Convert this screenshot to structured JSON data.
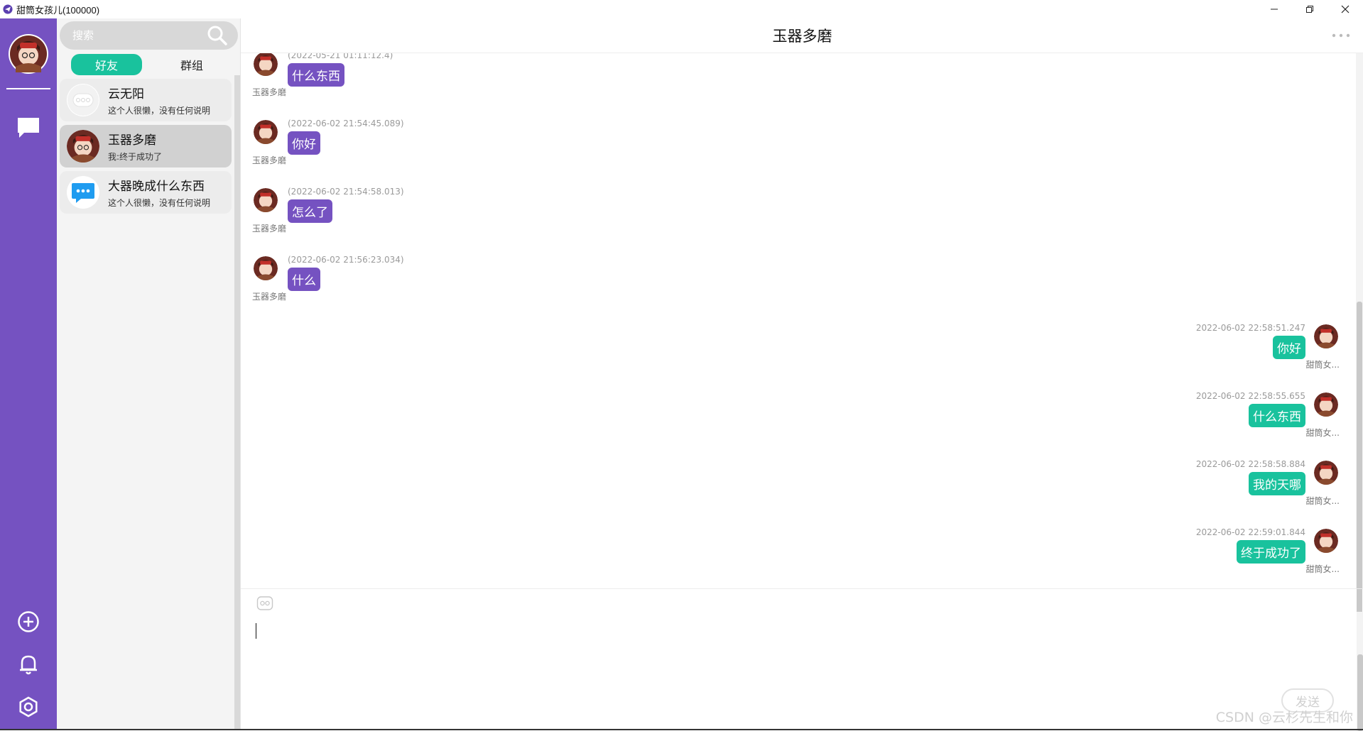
{
  "window": {
    "title": "甜筒女孩儿(100000)",
    "app_icon": "paper-plane-icon",
    "controls": [
      "minimize-icon",
      "restore-icon",
      "close-icon"
    ]
  },
  "colors": {
    "nav_bg": "#7552c1",
    "incoming_bubble": "#7552c1",
    "outgoing_bubble": "#19c29d",
    "active_tab": "#19c29d"
  },
  "nav": {
    "icons": [
      "user-avatar",
      "chat-icon",
      "add-circle-icon",
      "bell-icon",
      "settings-icon"
    ]
  },
  "contacts": {
    "search_placeholder": "搜索",
    "tabs": [
      {
        "label": "好友",
        "active": true
      },
      {
        "label": "群组",
        "active": false
      }
    ],
    "items": [
      {
        "name": "云无阳",
        "subtitle": "这个人很懒，没有任何说明",
        "avatar": "default-avatar-icon",
        "selected": false
      },
      {
        "name": "玉器多磨",
        "subtitle": "我:终于成功了",
        "avatar": "girl-avatar",
        "selected": true
      },
      {
        "name": "大器晚成什么东西",
        "subtitle": "这个人很懒，没有任何说明",
        "avatar": "blue-chat-avatar-icon",
        "selected": false
      }
    ]
  },
  "chat": {
    "title": "玉器多磨",
    "messages_in": [
      {
        "time": "(2022-05-21 01:11:12.4)",
        "text": "什么东西",
        "sender": "玉器多磨"
      },
      {
        "time": "(2022-06-02 21:54:45.089)",
        "text": "你好",
        "sender": "玉器多磨"
      },
      {
        "time": "(2022-06-02 21:54:58.013)",
        "text": "怎么了",
        "sender": "玉器多磨"
      },
      {
        "time": "(2022-06-02 21:56:23.034)",
        "text": "什么",
        "sender": "玉器多磨"
      }
    ],
    "messages_out": [
      {
        "time": "2022-06-02 22:58:51.247",
        "text": "你好",
        "sender": "甜筒女..."
      },
      {
        "time": "2022-06-02 22:58:55.655",
        "text": "什么东西",
        "sender": "甜筒女..."
      },
      {
        "time": "2022-06-02 22:58:58.884",
        "text": "我的天哪",
        "sender": "甜筒女..."
      },
      {
        "time": "2022-06-02 22:59:01.844",
        "text": "终于成功了",
        "sender": "甜筒女..."
      }
    ],
    "composer": {
      "value": "",
      "send_label": "发送"
    }
  },
  "watermark": "CSDN @云杉先生和你"
}
